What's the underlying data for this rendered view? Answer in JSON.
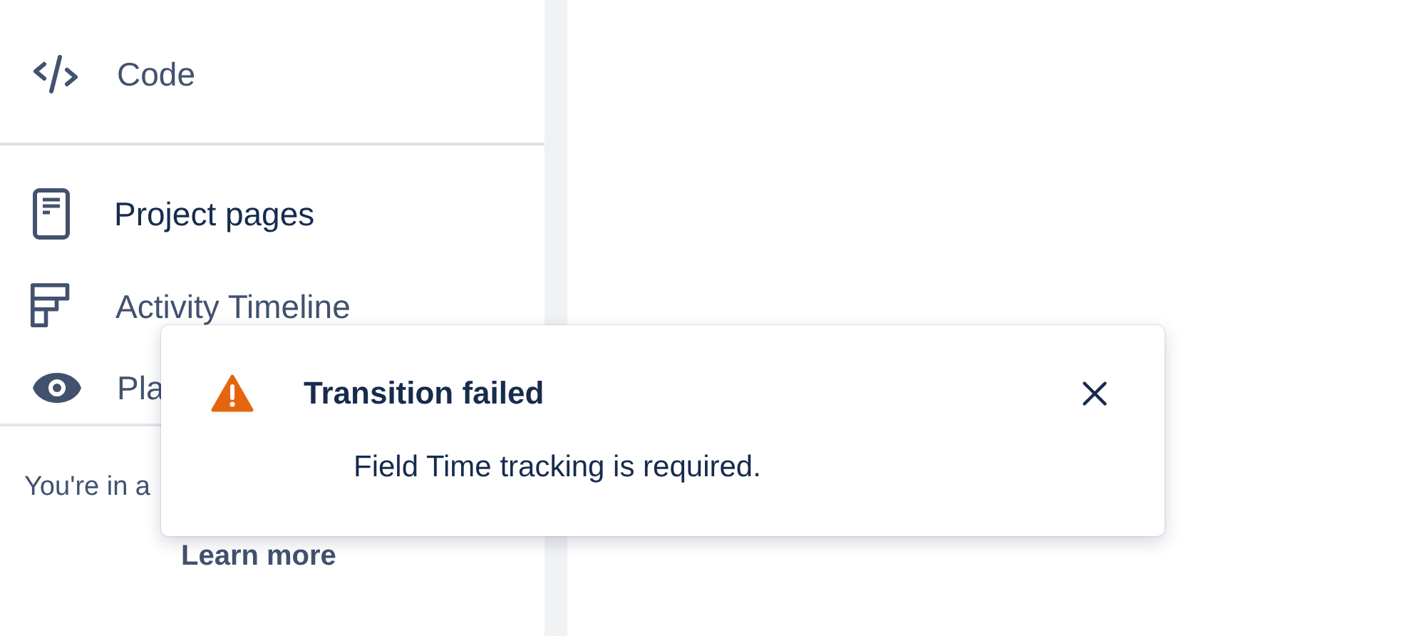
{
  "sidebar": {
    "items": [
      {
        "kind": "code",
        "label": "Code"
      },
      {
        "kind": "divider"
      },
      {
        "kind": "page",
        "label": "Project pages"
      },
      {
        "kind": "timeline",
        "label": "Activity Timeline"
      },
      {
        "kind": "eye",
        "label": "Pla"
      }
    ],
    "footer": {
      "text": "You're in a",
      "link": "Learn more"
    }
  },
  "flag": {
    "kind": "warning",
    "title": "Transition failed",
    "message": "Field Time tracking is required."
  }
}
